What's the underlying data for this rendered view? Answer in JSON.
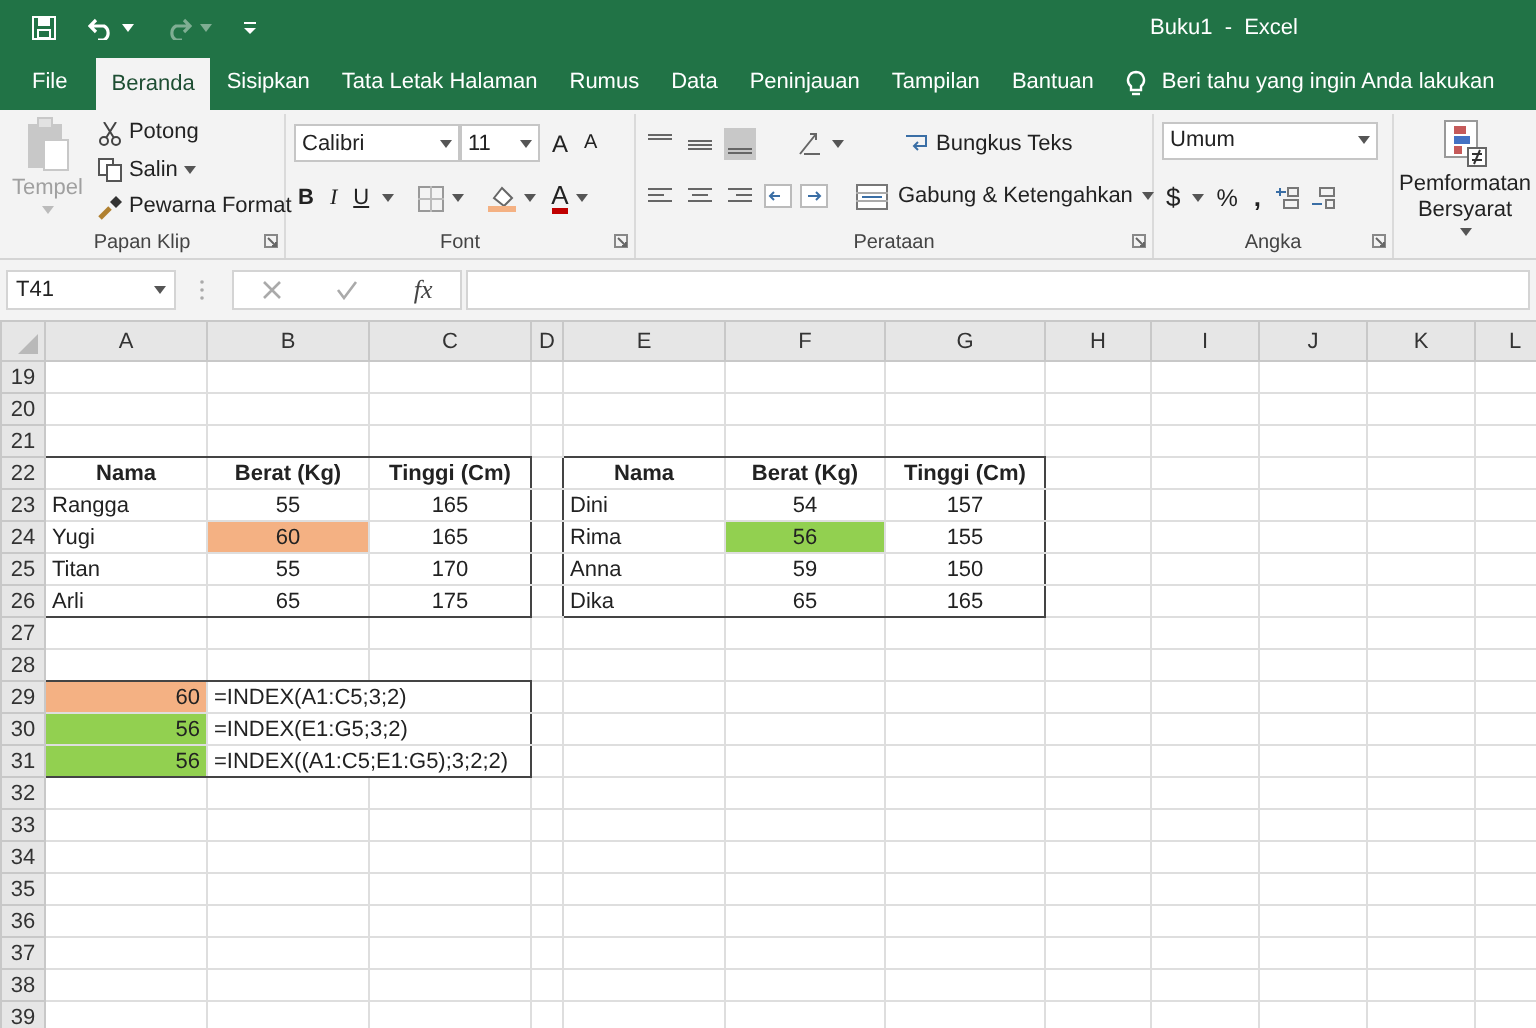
{
  "window": {
    "title": "Buku1  -  Excel"
  },
  "tabs": [
    {
      "label": "File",
      "selected": false
    },
    {
      "label": "Beranda",
      "selected": true
    },
    {
      "label": "Sisipkan",
      "selected": false
    },
    {
      "label": "Tata Letak Halaman",
      "selected": false
    },
    {
      "label": "Rumus",
      "selected": false
    },
    {
      "label": "Data",
      "selected": false
    },
    {
      "label": "Peninjauan",
      "selected": false
    },
    {
      "label": "Tampilan",
      "selected": false
    },
    {
      "label": "Bantuan",
      "selected": false
    }
  ],
  "tell_me": "Beri tahu yang ingin Anda lakukan",
  "clipboard": {
    "label": "Papan Klip",
    "paste": {
      "label": "Tempel",
      "disabled": true
    },
    "cut": "Potong",
    "copy": "Salin",
    "format_painter": "Pewarna Format"
  },
  "font": {
    "label": "Font",
    "family": "Calibri",
    "size": "11",
    "grow": "A",
    "shrink": "A",
    "bold": "B",
    "italic": "I",
    "underline": "U",
    "font_color": "A"
  },
  "alignment": {
    "label": "Perataan",
    "wrap": "Bungkus Teks",
    "merge": "Gabung & Ketengahkan"
  },
  "number": {
    "label": "Angka",
    "format": "Umum",
    "currency": "$",
    "percent": "%",
    "comma": ","
  },
  "styles": {
    "conditional": "Pemformatan Bersyarat"
  },
  "formula_bar": {
    "name_box": "T41",
    "function_label": "fx"
  },
  "sheet": {
    "columns": [
      "A",
      "B",
      "C",
      "D",
      "E",
      "F",
      "G",
      "H",
      "I",
      "J",
      "K",
      "L"
    ],
    "rows": [
      {
        "number": "19"
      },
      {
        "number": "20"
      },
      {
        "number": "21"
      },
      {
        "number": "22",
        "cells": [
          {
            "text": "Nama",
            "kind": "header"
          },
          {
            "text": "Berat (Kg)",
            "kind": "header"
          },
          {
            "text": "Tinggi (Cm)",
            "kind": "header"
          },
          null,
          {
            "text": "Nama",
            "kind": "header"
          },
          {
            "text": "Berat (Kg)",
            "kind": "header"
          },
          {
            "text": "Tinggi (Cm)",
            "kind": "header"
          }
        ]
      },
      {
        "number": "23",
        "cells": [
          {
            "text": "Rangga",
            "kind": "label"
          },
          {
            "text": "55",
            "kind": "number"
          },
          {
            "text": "165",
            "kind": "number"
          },
          null,
          {
            "text": "Dini",
            "kind": "label"
          },
          {
            "text": "54",
            "kind": "number"
          },
          {
            "text": "157",
            "kind": "number"
          }
        ]
      },
      {
        "number": "24",
        "cells": [
          {
            "text": "Yugi",
            "kind": "label"
          },
          {
            "text": "60",
            "kind": "number",
            "color": "#f4b183"
          },
          {
            "text": "165",
            "kind": "number"
          },
          null,
          {
            "text": "Rima",
            "kind": "label"
          },
          {
            "text": "56",
            "kind": "number",
            "color": "#92d050"
          },
          {
            "text": "155",
            "kind": "number"
          }
        ]
      },
      {
        "number": "25",
        "cells": [
          {
            "text": "Titan",
            "kind": "label"
          },
          {
            "text": "55",
            "kind": "number"
          },
          {
            "text": "170",
            "kind": "number"
          },
          null,
          {
            "text": "Anna",
            "kind": "label"
          },
          {
            "text": "59",
            "kind": "number"
          },
          {
            "text": "150",
            "kind": "number"
          }
        ]
      },
      {
        "number": "26",
        "cells": [
          {
            "text": "Arli",
            "kind": "label"
          },
          {
            "text": "65",
            "kind": "number"
          },
          {
            "text": "175",
            "kind": "number"
          },
          null,
          {
            "text": "Dika",
            "kind": "label"
          },
          {
            "text": "65",
            "kind": "number"
          },
          {
            "text": "165",
            "kind": "number"
          }
        ]
      },
      {
        "number": "27"
      },
      {
        "number": "28"
      },
      {
        "number": "29",
        "cells": [
          {
            "text": "60",
            "kind": "result",
            "color": "#f4b183"
          },
          {
            "text": "=INDEX(A1:C5;3;2)",
            "kind": "formula"
          }
        ]
      },
      {
        "number": "30",
        "cells": [
          {
            "text": "56",
            "kind": "result",
            "color": "#92d050"
          },
          {
            "text": "=INDEX(E1:G5;3;2)",
            "kind": "formula"
          }
        ]
      },
      {
        "number": "31",
        "cells": [
          {
            "text": "56",
            "kind": "result",
            "color": "#92d050"
          },
          {
            "text": "=INDEX((A1:C5;E1:G5);3;2;2)",
            "kind": "formula"
          }
        ]
      },
      {
        "number": "32"
      },
      {
        "number": "33"
      },
      {
        "number": "34"
      },
      {
        "number": "35"
      },
      {
        "number": "36"
      },
      {
        "number": "37"
      },
      {
        "number": "38"
      },
      {
        "number": "39"
      }
    ]
  }
}
